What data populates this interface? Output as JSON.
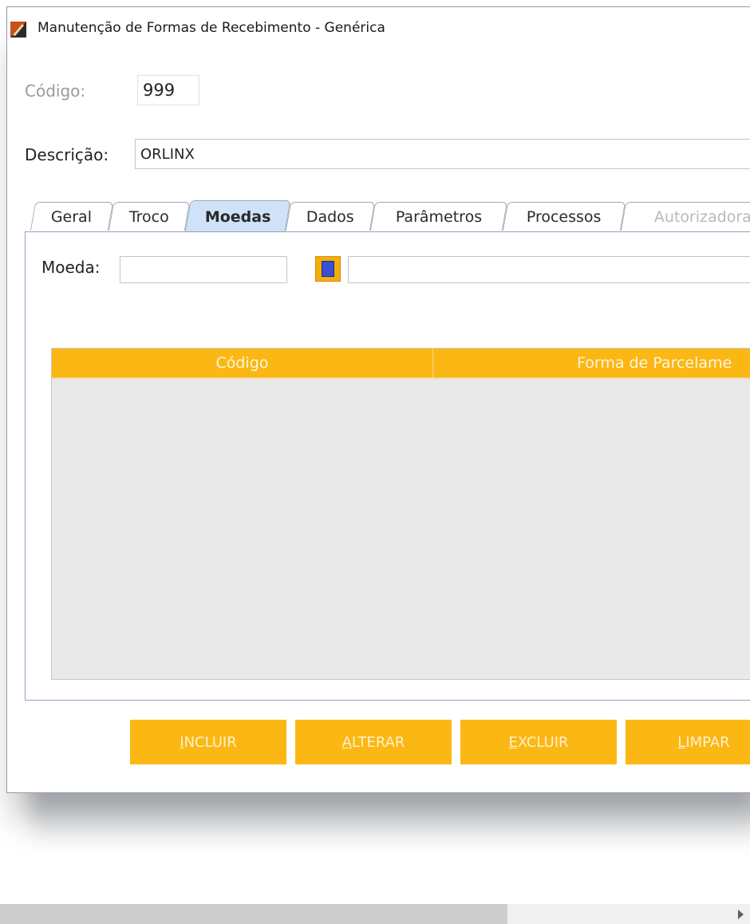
{
  "window": {
    "title": "Manutenção de Formas de Recebimento - Genérica"
  },
  "form": {
    "codigo_label": "Código:",
    "codigo_value": "999",
    "descricao_label": "Descrição:",
    "descricao_value": "ORLINX"
  },
  "tabs": [
    {
      "label": "Geral",
      "state": "normal"
    },
    {
      "label": "Troco",
      "state": "normal"
    },
    {
      "label": "Moedas",
      "state": "active"
    },
    {
      "label": "Dados",
      "state": "normal"
    },
    {
      "label": "Parâmetros",
      "state": "normal"
    },
    {
      "label": "Processos",
      "state": "normal"
    },
    {
      "label": "Autorizadora",
      "state": "disabled"
    }
  ],
  "moedas_tab": {
    "moeda_label": "Moeda:",
    "moeda_code_value": "",
    "moeda_desc_value": "",
    "lookup_icon": "lookup-icon"
  },
  "grid": {
    "columns": [
      "Código",
      "Forma de Parcelame"
    ]
  },
  "actions": {
    "incluir": {
      "mnemonic": "I",
      "rest": "NCLUIR"
    },
    "alterar": {
      "mnemonic": "A",
      "rest": "LTERAR"
    },
    "excluir": {
      "mnemonic": "E",
      "rest": "XCLUIR"
    },
    "limpar": {
      "mnemonic": "L",
      "rest": "IMPAR"
    }
  },
  "colors": {
    "accent": "#FBB713",
    "active_tab": "#CFE2F7",
    "grid_body": "#E9E9E9"
  }
}
